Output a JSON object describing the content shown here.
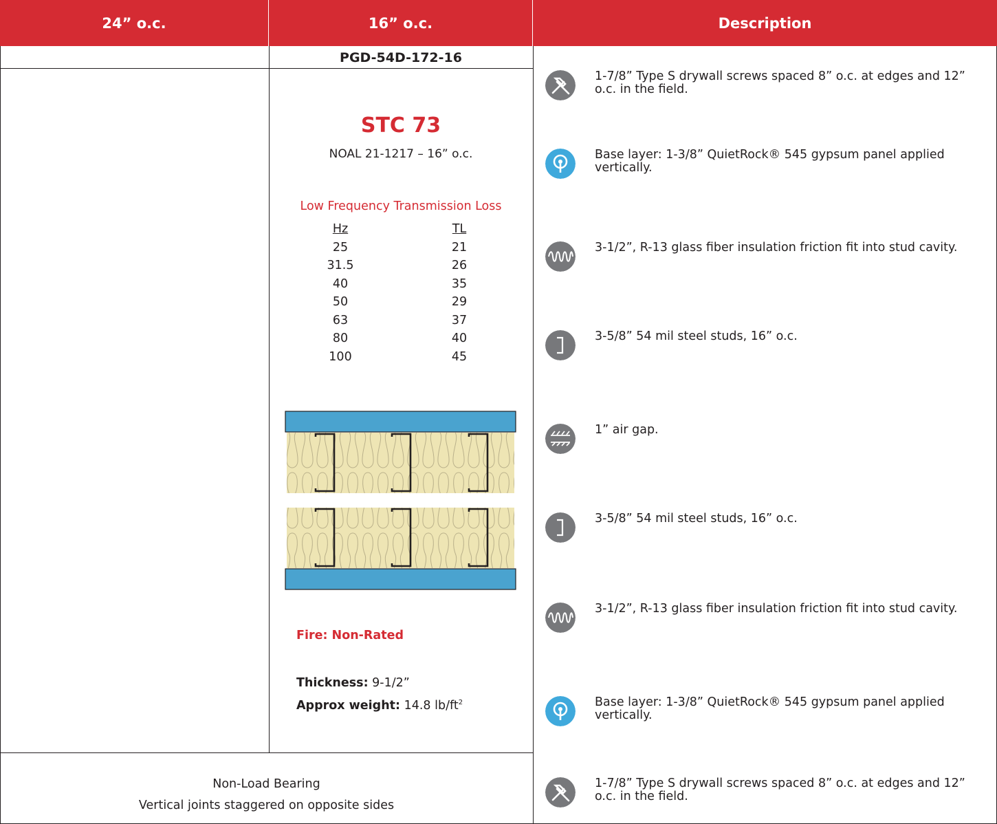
{
  "header": {
    "col1": "24” o.c.",
    "col2": "16” o.c.",
    "col3": "Description"
  },
  "assembly": {
    "product_code": "PGD-54D-172-16",
    "stc": "STC 73",
    "report": "NOAL 21-1217 – 16” o.c.",
    "lf_title": "Low Frequency Transmission Loss",
    "lf_hz_header": "Hz",
    "lf_tl_header": "TL",
    "lf_rows": [
      {
        "hz": "25",
        "tl": "21"
      },
      {
        "hz": "31.5",
        "tl": "26"
      },
      {
        "hz": "40",
        "tl": "35"
      },
      {
        "hz": "50",
        "tl": "29"
      },
      {
        "hz": "63",
        "tl": "37"
      },
      {
        "hz": "80",
        "tl": "40"
      },
      {
        "hz": "100",
        "tl": "45"
      }
    ],
    "fire": "Fire: Non-Rated",
    "thickness_label": "Thickness:",
    "thickness_value": "9-1/2”",
    "weight_label": "Approx weight:",
    "weight_value": "14.8 lb/ft",
    "weight_sup": "2"
  },
  "bearing": {
    "line1": "Non-Load Bearing",
    "line2": "Vertical joints staggered on opposite sides"
  },
  "descriptions": [
    {
      "icon": "screw-hammer-icon",
      "text": "1-7/8” Type S drywall screws spaced 8” o.c. at edges and 12” o.c. in the field."
    },
    {
      "icon": "quietrock-panel-icon",
      "text": "Base layer: 1-3/8” QuietRock® 545 gypsum panel applied vertically."
    },
    {
      "icon": "insulation-icon",
      "text": "3-1/2”, R-13 glass fiber insulation friction fit into stud cavity."
    },
    {
      "icon": "steel-stud-icon",
      "text": "3-5/8” 54 mil steel studs, 16” o.c."
    },
    {
      "icon": "air-gap-icon",
      "text": "1” air gap."
    },
    {
      "icon": "steel-stud-icon",
      "text": "3-5/8” 54 mil steel studs, 16” o.c."
    },
    {
      "icon": "insulation-icon",
      "text": "3-1/2”, R-13 glass fiber insulation friction fit into stud cavity."
    },
    {
      "icon": "quietrock-panel-icon",
      "text": "Base layer: 1-3/8” QuietRock® 545 gypsum panel applied vertically."
    },
    {
      "icon": "screw-hammer-icon",
      "text": "1-7/8” Type S drywall screws spaced 8” o.c. at edges and 12” o.c. in the field."
    }
  ],
  "colors": {
    "header_red": "#d52b33",
    "panel_blue": "#4aa3cf",
    "insulation_fill": "#eee5b4",
    "icon_gray": "#77787b",
    "icon_blue": "#3fa9dc"
  }
}
